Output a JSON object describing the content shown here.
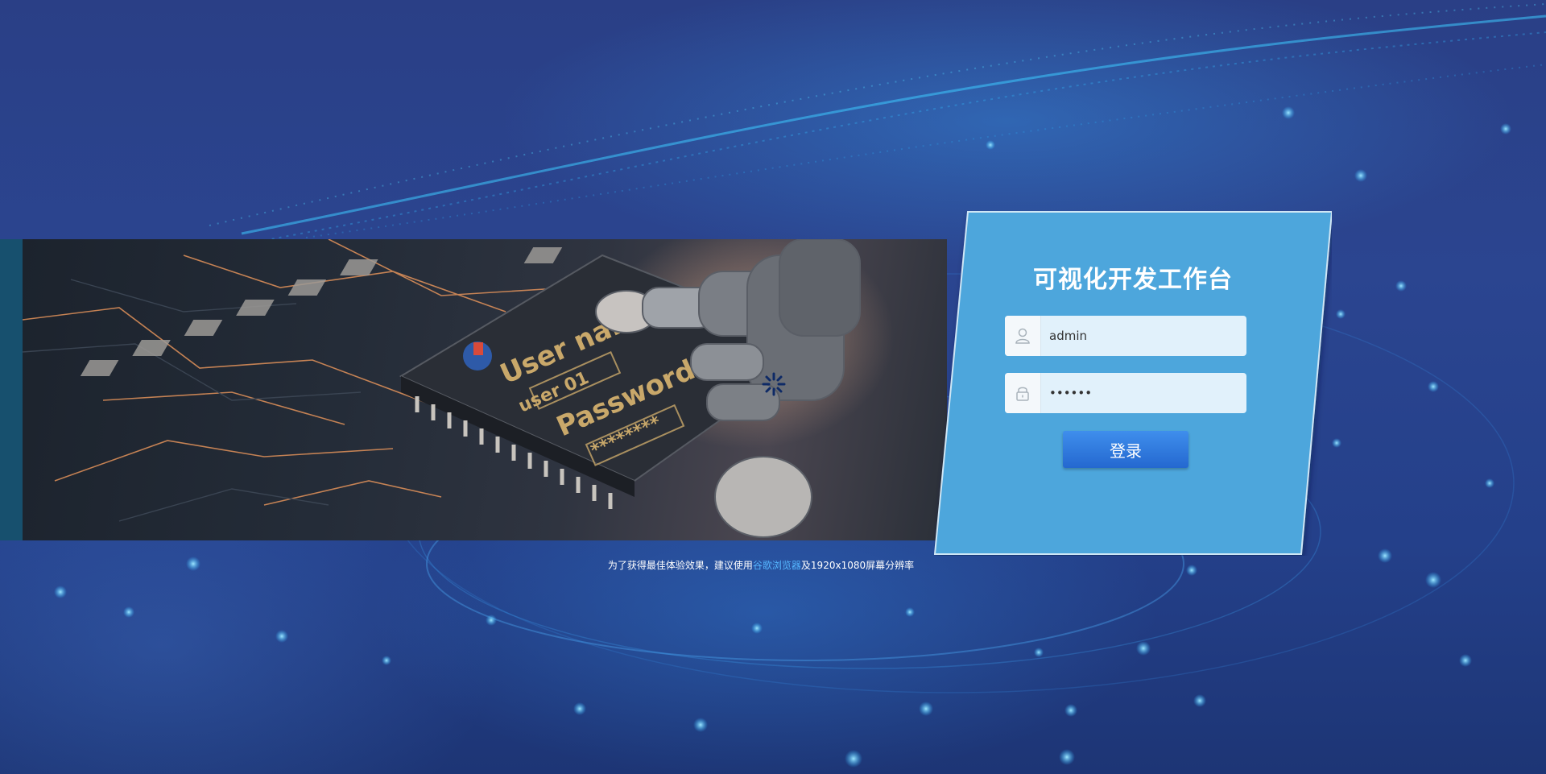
{
  "login": {
    "title": "可视化开发工作台",
    "username_value": "admin",
    "password_value": "••••••",
    "submit_label": "登录"
  },
  "notice": {
    "prefix": "为了获得最佳体验效果，建议使用",
    "browser_link": "谷歌浏览器",
    "suffix": "及1920x1080屏幕分辨率"
  },
  "banner": {
    "chip_text": [
      "User name",
      "user 01",
      "Password",
      "********"
    ]
  },
  "icons": {
    "username_field": "user-icon",
    "password_field": "lock-icon",
    "loading": "spinner-icon"
  },
  "colors": {
    "card": "#4da6dc",
    "button": "#2a6fd6",
    "link": "#55b6ff",
    "background": "#2b4590"
  }
}
